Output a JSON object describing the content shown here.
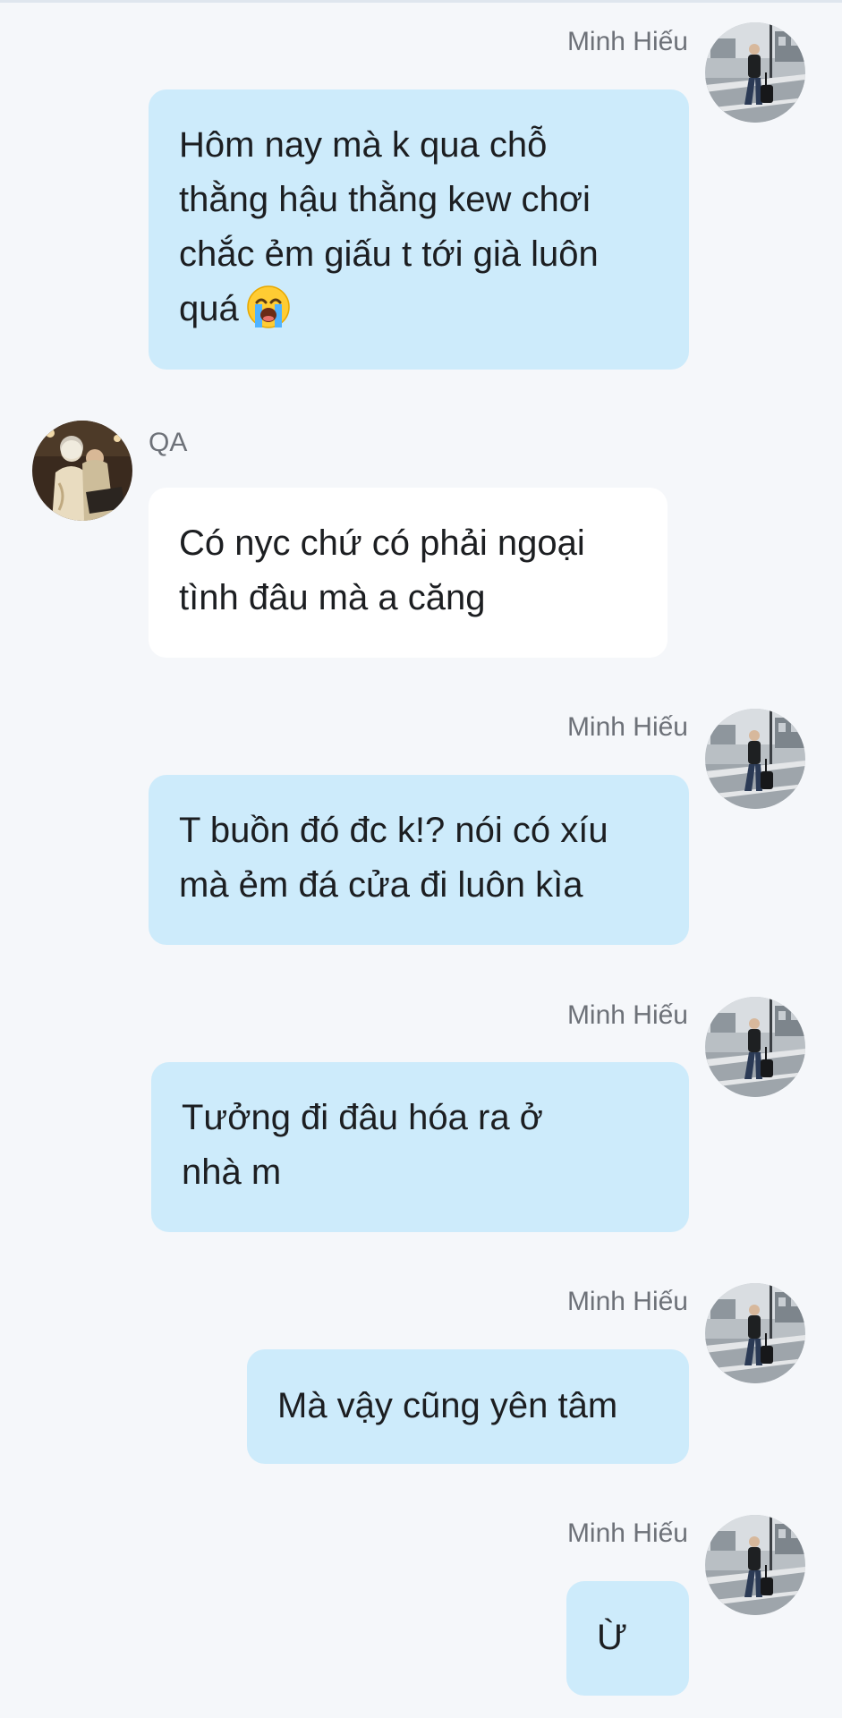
{
  "messages": [
    {
      "sender": "Minh Hiếu",
      "lines": [
        "Hôm nay mà k qua chỗ",
        "thằng hậu thằng kew chơi",
        "chắc ẻm giấu t tới già luôn",
        "quá"
      ],
      "emoji": "loudly-crying-face"
    },
    {
      "sender": "QA",
      "lines": [
        "Có nyc chứ có phải ngoại",
        "tình đâu mà a căng"
      ]
    },
    {
      "sender": "Minh Hiếu",
      "lines": [
        "T buồn đó đc k!? nói có xíu",
        "mà ẻm đá cửa đi luôn kìa"
      ]
    },
    {
      "sender": "Minh Hiếu",
      "lines": [
        "Tưởng đi đâu hóa ra ở",
        "nhà m"
      ]
    },
    {
      "sender": "Minh Hiếu",
      "lines": [
        "Mà vậy cũng yên tâm"
      ]
    },
    {
      "sender": "Minh Hiếu",
      "lines": [
        "Ừ"
      ]
    }
  ],
  "colors": {
    "background": "#f5f7fa",
    "own_bubble": "#cdebfb",
    "other_bubble": "#ffffff",
    "sender_name": "#6d7178",
    "message_text": "#1c1e21"
  }
}
